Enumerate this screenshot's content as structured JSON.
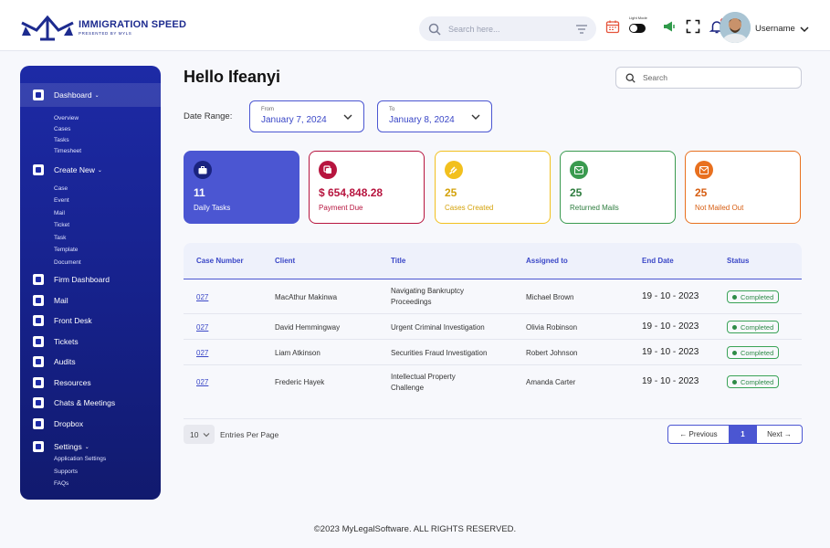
{
  "brand": {
    "name": "IMMIGRATION SPEED",
    "tagline": "PRESENTED BY MYLS"
  },
  "header": {
    "search_placeholder": "Search here...",
    "toggle_label": "Light Mode",
    "username": "Username"
  },
  "sidebar": {
    "sections": [
      {
        "label": "Dashboard",
        "caret": true,
        "sub": [
          "Overview",
          "Cases",
          "Tasks",
          "Timesheet"
        ]
      },
      {
        "label": "Create New",
        "caret": true,
        "sub": [
          "Case",
          "Event",
          "Mail",
          "Ticket",
          "Task",
          "Template",
          "Document"
        ]
      },
      {
        "label": "Firm Dashboard"
      },
      {
        "label": "Mail"
      },
      {
        "label": "Front Desk"
      },
      {
        "label": "Tickets"
      },
      {
        "label": "Audits"
      },
      {
        "label": "Resources"
      },
      {
        "label": "Chats & Meetings"
      },
      {
        "label": "Dropbox"
      },
      {
        "label": "Settings",
        "caret": true,
        "sub": [
          "Application Settings",
          "Supports",
          "FAQs"
        ]
      }
    ]
  },
  "main": {
    "greeting": "Hello Ifeanyi",
    "search_placeholder": "Search",
    "date_range_label": "Date Range:",
    "from": {
      "label": "From",
      "value": "January 7, 2024"
    },
    "to": {
      "label": "To",
      "value": "January 8, 2024"
    }
  },
  "cards": [
    {
      "value": "11",
      "label": "Daily Tasks",
      "color": "#4b56d2",
      "icon": "briefcase-icon"
    },
    {
      "value": "$ 654,848.28",
      "label": "Payment Due",
      "color": "#b7153f",
      "icon": "money-icon"
    },
    {
      "value": "25",
      "label": "Cases Created",
      "color": "#f2c01e",
      "icon": "gavel-icon"
    },
    {
      "value": "25",
      "label": "Returned Mails",
      "color": "#3a9a4f",
      "icon": "mail-return-icon"
    },
    {
      "value": "25",
      "label": "Not Mailed Out",
      "color": "#e8701f",
      "icon": "mail-out-icon"
    }
  ],
  "table": {
    "columns": [
      "Case Number",
      "Client",
      "Title",
      "Assigned to",
      "End Date",
      "Status"
    ],
    "rows": [
      {
        "case": "027",
        "client": "MacAthur Makinwa",
        "title": [
          "Navigating Bankruptcy",
          "Proceedings"
        ],
        "assigned": "Michael Brown",
        "end": "19 - 10 - 2023",
        "status": "Completed"
      },
      {
        "case": "027",
        "client": "David Hemmingway",
        "title": [
          "Urgent Criminal Investigation"
        ],
        "assigned": "Olivia Robinson",
        "end": "19 - 10 - 2023",
        "status": "Completed"
      },
      {
        "case": "027",
        "client": "Liam Atkinson",
        "title": [
          "Securities Fraud Investigation"
        ],
        "assigned": "Robert Johnson",
        "end": "19 - 10 - 2023",
        "status": "Completed"
      },
      {
        "case": "027",
        "client": "Frederic Hayek",
        "title": [
          "Intellectual Property",
          "Challenge"
        ],
        "assigned": "Amanda Carter",
        "end": "19 - 10 - 2023",
        "status": "Completed"
      }
    ]
  },
  "pagination": {
    "per_page": "10",
    "per_page_label": "Entries Per Page",
    "previous": "← Previous",
    "current": "1",
    "next": "Next →"
  },
  "footer": "©2023 MyLegalSoftware. ALL RIGHTS RESERVED."
}
